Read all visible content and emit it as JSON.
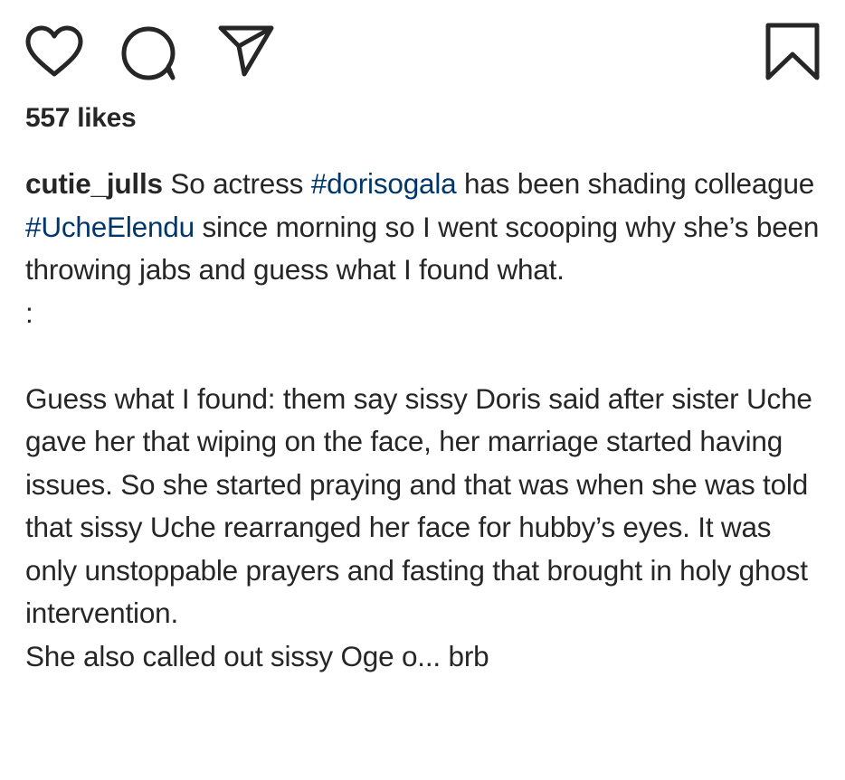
{
  "actions": {
    "like_icon": "heart-outline",
    "comment_icon": "comment-bubble",
    "share_icon": "paper-plane",
    "save_icon": "bookmark-outline"
  },
  "likes": {
    "text": "557 likes"
  },
  "caption": {
    "username": "cutie_julls",
    "seg1": " So actress ",
    "hashtag1": "#dorisogala",
    "seg2": " has been shading colleague ",
    "hashtag2": "#UcheElendu",
    "seg3": " since morning so I went scooping why she’s been throwing jabs and guess what I found what.",
    "separator": ":",
    "paragraph2": "Guess what I found: them say sissy Doris said after sister Uche gave her that wiping on the face, her marriage started having issues. So she started praying and that was when she was told that sissy Uche rearranged her face for hubby’s eyes. It was only unstoppable prayers and fasting that brought in holy ghost intervention.",
    "paragraph3": "She also called out sissy Oge o... brb"
  },
  "colors": {
    "text": "#262626",
    "hashtag": "#00376b",
    "background": "#ffffff"
  }
}
